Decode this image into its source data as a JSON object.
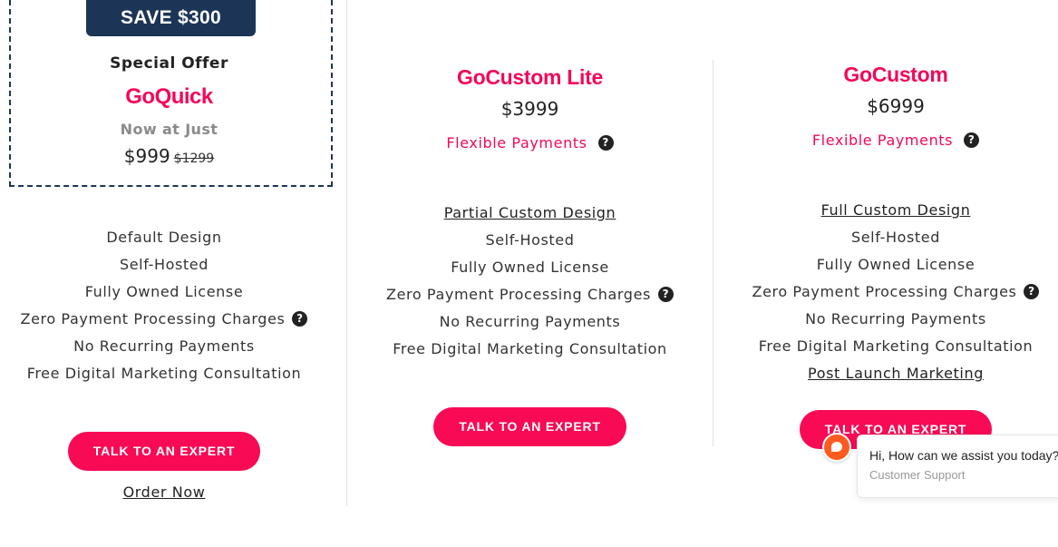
{
  "colors": {
    "brand_pink": "#f2085b",
    "button_pink": "#f80a55",
    "navy": "#1c3557"
  },
  "offer": {
    "badge": "SAVE $300",
    "title": "Special Offer",
    "name": "GoQuick",
    "subtitle": "Now at Just",
    "price": "$999",
    "old_price": "$1299"
  },
  "plan_goquick": {
    "features": [
      "Default Design",
      "Self-Hosted",
      "Fully Owned License",
      "Zero Payment Processing Charges",
      "No Recurring Payments",
      "Free Digital Marketing Consultation"
    ],
    "cta": "TALK TO AN EXPERT",
    "order_link": "Order Now"
  },
  "plan_lite": {
    "name": "GoCustom Lite",
    "price": "$3999",
    "payments": "Flexible Payments",
    "features": [
      "Partial Custom Design",
      "Self-Hosted",
      "Fully Owned License",
      "Zero Payment Processing Charges",
      "No Recurring Payments",
      "Free Digital Marketing Consultation"
    ],
    "cta": "TALK TO AN EXPERT"
  },
  "plan_custom": {
    "name": "GoCustom",
    "price": "$6999",
    "payments": "Flexible Payments",
    "features": [
      "Full Custom Design",
      "Self-Hosted",
      "Fully Owned License",
      "Zero Payment Processing Charges",
      "No Recurring Payments",
      "Free Digital Marketing Consultation",
      "Post Launch Marketing"
    ],
    "cta": "TALK TO AN EXPERT"
  },
  "help_icon": "question-mark-icon",
  "chat": {
    "message": "Hi, How can we assist you today?",
    "sender": "Customer Support",
    "avatar_icon": "chat-icon"
  }
}
